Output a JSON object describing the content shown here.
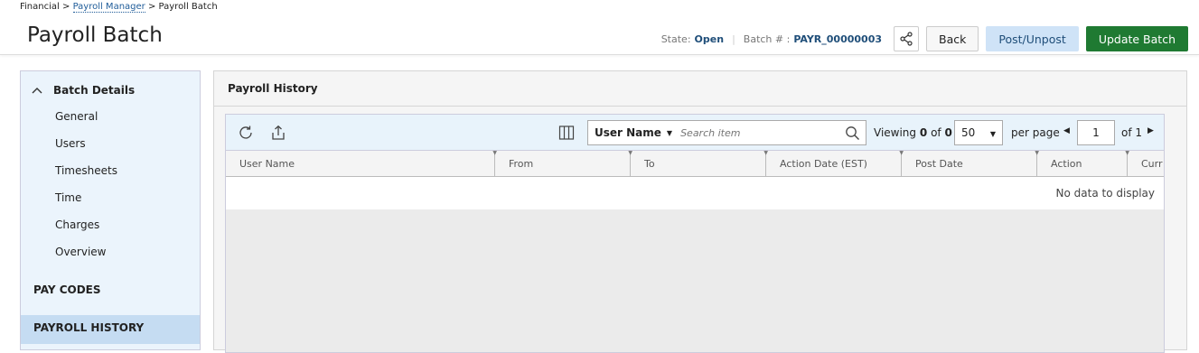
{
  "breadcrumb": {
    "root": "Financial",
    "parent": "Payroll Manager",
    "current": "Payroll Batch",
    "sep": ">"
  },
  "page": {
    "title": "Payroll Batch"
  },
  "header": {
    "state_label": "State:",
    "state_value": "Open",
    "batch_label": "Batch # :",
    "batch_value": "PAYR_00000003",
    "back_label": "Back",
    "post_label": "Post/Unpost",
    "update_label": "Update Batch"
  },
  "sidebar": {
    "section_title": "Batch Details",
    "items": [
      {
        "label": "General"
      },
      {
        "label": "Users"
      },
      {
        "label": "Timesheets"
      },
      {
        "label": "Time"
      },
      {
        "label": "Charges"
      },
      {
        "label": "Overview"
      }
    ],
    "pay_codes": "PAY CODES",
    "payroll_history": "PAYROLL HISTORY"
  },
  "panel": {
    "title": "Payroll History"
  },
  "grid": {
    "search_field": "User Name",
    "search_placeholder": "Search item",
    "viewing_label": "Viewing",
    "viewing_from": "0",
    "viewing_of": "of",
    "viewing_total": "0",
    "per_page_value": "50",
    "per_page_label": "per page",
    "page_value": "1",
    "page_of": "of 1",
    "columns": [
      "User Name",
      "From",
      "To",
      "Action Date (EST)",
      "Post Date",
      "Action",
      "Curr"
    ],
    "empty_text": "No data to display"
  },
  "colors": {
    "accent": "#1f7a32",
    "link": "#1f5c99",
    "sidebar_bg": "#ebf4fc",
    "active_bg": "#c5dcf2"
  }
}
